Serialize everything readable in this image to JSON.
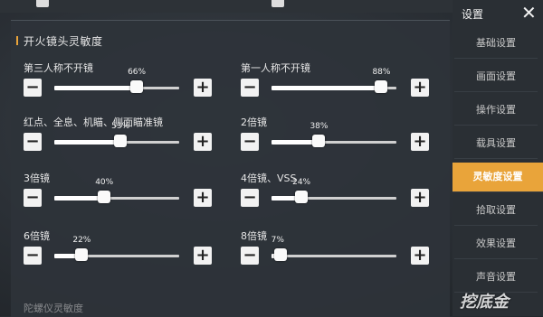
{
  "header": {
    "title": "设置"
  },
  "sidebar": {
    "items": [
      {
        "label": "基础设置",
        "active": false
      },
      {
        "label": "画面设置",
        "active": false
      },
      {
        "label": "操作设置",
        "active": false
      },
      {
        "label": "载具设置",
        "active": false
      },
      {
        "label": "灵敏度设置",
        "active": true
      },
      {
        "label": "拾取设置",
        "active": false
      },
      {
        "label": "效果设置",
        "active": false
      },
      {
        "label": "声音设置",
        "active": false
      }
    ]
  },
  "section": {
    "title": "开火镜头灵敏度",
    "items": [
      {
        "label": "第三人称不开镜",
        "value": 66,
        "display": "66%"
      },
      {
        "label": "第一人称不开镜",
        "value": 88,
        "display": "88%"
      },
      {
        "label": "红点、全息、机瞄、侧面瞄准镜",
        "value": 53,
        "display": "53%"
      },
      {
        "label": "2倍镜",
        "value": 38,
        "display": "38%"
      },
      {
        "label": "3倍镜",
        "value": 40,
        "display": "40%"
      },
      {
        "label": "4倍镜、VSS",
        "value": 24,
        "display": "24%"
      },
      {
        "label": "6倍镜",
        "value": 22,
        "display": "22%"
      },
      {
        "label": "8倍镜",
        "value": 7,
        "display": "7%"
      }
    ]
  },
  "controls": {
    "minus": "−",
    "plus": "+",
    "close": "✕"
  },
  "next_section": {
    "title": "陀螺仪灵敏度"
  },
  "watermark": "挖底金",
  "colors": {
    "accent": "#e9a43a",
    "panel": "#2e3339"
  }
}
